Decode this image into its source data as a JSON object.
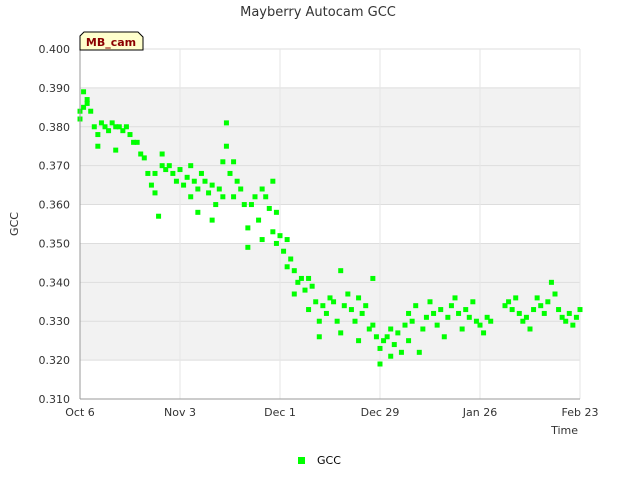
{
  "chart_data": {
    "type": "scatter",
    "title": "Mayberry Autocam GCC",
    "xlabel": "Time",
    "ylabel": "GCC",
    "badge": "MB_cam",
    "x_type": "date",
    "x_range": [
      "2014-10-06",
      "2015-02-23"
    ],
    "ylim": [
      0.31,
      0.4
    ],
    "yticks": [
      "0.310",
      "0.320",
      "0.330",
      "0.340",
      "0.350",
      "0.360",
      "0.370",
      "0.380",
      "0.390",
      "0.400"
    ],
    "xticks": [
      {
        "date": "2014-10-06",
        "label": "Oct 6"
      },
      {
        "date": "2014-11-03",
        "label": "Nov 3"
      },
      {
        "date": "2014-12-01",
        "label": "Dec 1"
      },
      {
        "date": "2014-12-29",
        "label": "Dec 29"
      },
      {
        "date": "2015-01-26",
        "label": "Jan 26"
      },
      {
        "date": "2015-02-23",
        "label": "Feb 23"
      }
    ],
    "grid": true,
    "legend_position": "bottom-center",
    "series": [
      {
        "name": "GCC",
        "color": "#00ff00",
        "points": [
          [
            "2014-10-06",
            0.382
          ],
          [
            "2014-10-06",
            0.384
          ],
          [
            "2014-10-07",
            0.385
          ],
          [
            "2014-10-07",
            0.389
          ],
          [
            "2014-10-08",
            0.387
          ],
          [
            "2014-10-08",
            0.386
          ],
          [
            "2014-10-09",
            0.384
          ],
          [
            "2014-10-10",
            0.38
          ],
          [
            "2014-10-11",
            0.378
          ],
          [
            "2014-10-11",
            0.375
          ],
          [
            "2014-10-12",
            0.381
          ],
          [
            "2014-10-13",
            0.38
          ],
          [
            "2014-10-14",
            0.379
          ],
          [
            "2014-10-15",
            0.381
          ],
          [
            "2014-10-16",
            0.38
          ],
          [
            "2014-10-16",
            0.374
          ],
          [
            "2014-10-17",
            0.38
          ],
          [
            "2014-10-18",
            0.379
          ],
          [
            "2014-10-19",
            0.38
          ],
          [
            "2014-10-20",
            0.378
          ],
          [
            "2014-10-21",
            0.376
          ],
          [
            "2014-10-22",
            0.376
          ],
          [
            "2014-10-23",
            0.373
          ],
          [
            "2014-10-24",
            0.372
          ],
          [
            "2014-10-25",
            0.368
          ],
          [
            "2014-10-26",
            0.365
          ],
          [
            "2014-10-27",
            0.363
          ],
          [
            "2014-10-27",
            0.368
          ],
          [
            "2014-10-28",
            0.357
          ],
          [
            "2014-10-29",
            0.37
          ],
          [
            "2014-10-29",
            0.373
          ],
          [
            "2014-10-30",
            0.369
          ],
          [
            "2014-10-31",
            0.37
          ],
          [
            "2014-11-01",
            0.368
          ],
          [
            "2014-11-02",
            0.366
          ],
          [
            "2014-11-03",
            0.369
          ],
          [
            "2014-11-04",
            0.365
          ],
          [
            "2014-11-05",
            0.367
          ],
          [
            "2014-11-06",
            0.37
          ],
          [
            "2014-11-06",
            0.362
          ],
          [
            "2014-11-07",
            0.366
          ],
          [
            "2014-11-08",
            0.358
          ],
          [
            "2014-11-08",
            0.364
          ],
          [
            "2014-11-09",
            0.368
          ],
          [
            "2014-11-10",
            0.366
          ],
          [
            "2014-11-11",
            0.363
          ],
          [
            "2014-11-12",
            0.365
          ],
          [
            "2014-11-12",
            0.356
          ],
          [
            "2014-11-13",
            0.36
          ],
          [
            "2014-11-14",
            0.364
          ],
          [
            "2014-11-15",
            0.362
          ],
          [
            "2014-11-15",
            0.371
          ],
          [
            "2014-11-16",
            0.375
          ],
          [
            "2014-11-16",
            0.381
          ],
          [
            "2014-11-17",
            0.368
          ],
          [
            "2014-11-18",
            0.371
          ],
          [
            "2014-11-18",
            0.362
          ],
          [
            "2014-11-19",
            0.366
          ],
          [
            "2014-11-20",
            0.364
          ],
          [
            "2014-11-21",
            0.36
          ],
          [
            "2014-11-22",
            0.354
          ],
          [
            "2014-11-22",
            0.349
          ],
          [
            "2014-11-23",
            0.36
          ],
          [
            "2014-11-24",
            0.362
          ],
          [
            "2014-11-25",
            0.356
          ],
          [
            "2014-11-26",
            0.364
          ],
          [
            "2014-11-26",
            0.351
          ],
          [
            "2014-11-27",
            0.362
          ],
          [
            "2014-11-28",
            0.359
          ],
          [
            "2014-11-29",
            0.366
          ],
          [
            "2014-11-29",
            0.353
          ],
          [
            "2014-11-30",
            0.358
          ],
          [
            "2014-11-30",
            0.35
          ],
          [
            "2014-12-01",
            0.352
          ],
          [
            "2014-12-02",
            0.348
          ],
          [
            "2014-12-03",
            0.344
          ],
          [
            "2014-12-03",
            0.351
          ],
          [
            "2014-12-04",
            0.346
          ],
          [
            "2014-12-05",
            0.343
          ],
          [
            "2014-12-05",
            0.337
          ],
          [
            "2014-12-06",
            0.34
          ],
          [
            "2014-12-07",
            0.341
          ],
          [
            "2014-12-08",
            0.338
          ],
          [
            "2014-12-09",
            0.341
          ],
          [
            "2014-12-09",
            0.333
          ],
          [
            "2014-12-10",
            0.339
          ],
          [
            "2014-12-11",
            0.335
          ],
          [
            "2014-12-12",
            0.33
          ],
          [
            "2014-12-12",
            0.326
          ],
          [
            "2014-12-13",
            0.334
          ],
          [
            "2014-12-14",
            0.332
          ],
          [
            "2014-12-15",
            0.336
          ],
          [
            "2014-12-16",
            0.335
          ],
          [
            "2014-12-17",
            0.33
          ],
          [
            "2014-12-18",
            0.343
          ],
          [
            "2014-12-18",
            0.327
          ],
          [
            "2014-12-19",
            0.334
          ],
          [
            "2014-12-20",
            0.337
          ],
          [
            "2014-12-21",
            0.333
          ],
          [
            "2014-12-22",
            0.33
          ],
          [
            "2014-12-23",
            0.336
          ],
          [
            "2014-12-23",
            0.325
          ],
          [
            "2014-12-24",
            0.332
          ],
          [
            "2014-12-25",
            0.334
          ],
          [
            "2014-12-26",
            0.328
          ],
          [
            "2014-12-27",
            0.329
          ],
          [
            "2014-12-27",
            0.341
          ],
          [
            "2014-12-28",
            0.326
          ],
          [
            "2014-12-29",
            0.323
          ],
          [
            "2014-12-29",
            0.319
          ],
          [
            "2014-12-30",
            0.325
          ],
          [
            "2014-12-31",
            0.326
          ],
          [
            "2015-01-01",
            0.328
          ],
          [
            "2015-01-01",
            0.321
          ],
          [
            "2015-01-02",
            0.324
          ],
          [
            "2015-01-03",
            0.327
          ],
          [
            "2015-01-04",
            0.322
          ],
          [
            "2015-01-05",
            0.329
          ],
          [
            "2015-01-06",
            0.332
          ],
          [
            "2015-01-06",
            0.325
          ],
          [
            "2015-01-07",
            0.33
          ],
          [
            "2015-01-08",
            0.334
          ],
          [
            "2015-01-09",
            0.322
          ],
          [
            "2015-01-10",
            0.328
          ],
          [
            "2015-01-11",
            0.331
          ],
          [
            "2015-01-12",
            0.335
          ],
          [
            "2015-01-13",
            0.332
          ],
          [
            "2015-01-14",
            0.329
          ],
          [
            "2015-01-15",
            0.333
          ],
          [
            "2015-01-16",
            0.326
          ],
          [
            "2015-01-17",
            0.331
          ],
          [
            "2015-01-18",
            0.334
          ],
          [
            "2015-01-19",
            0.336
          ],
          [
            "2015-01-20",
            0.332
          ],
          [
            "2015-01-21",
            0.328
          ],
          [
            "2015-01-22",
            0.333
          ],
          [
            "2015-01-23",
            0.331
          ],
          [
            "2015-01-24",
            0.335
          ],
          [
            "2015-01-25",
            0.33
          ],
          [
            "2015-01-26",
            0.329
          ],
          [
            "2015-01-27",
            0.327
          ],
          [
            "2015-01-28",
            0.331
          ],
          [
            "2015-01-29",
            0.33
          ],
          [
            "2015-02-02",
            0.334
          ],
          [
            "2015-02-03",
            0.335
          ],
          [
            "2015-02-04",
            0.333
          ],
          [
            "2015-02-05",
            0.336
          ],
          [
            "2015-02-06",
            0.332
          ],
          [
            "2015-02-07",
            0.33
          ],
          [
            "2015-02-08",
            0.331
          ],
          [
            "2015-02-09",
            0.328
          ],
          [
            "2015-02-10",
            0.333
          ],
          [
            "2015-02-11",
            0.336
          ],
          [
            "2015-02-12",
            0.334
          ],
          [
            "2015-02-13",
            0.332
          ],
          [
            "2015-02-14",
            0.335
          ],
          [
            "2015-02-15",
            0.34
          ],
          [
            "2015-02-16",
            0.337
          ],
          [
            "2015-02-17",
            0.333
          ],
          [
            "2015-02-18",
            0.331
          ],
          [
            "2015-02-19",
            0.33
          ],
          [
            "2015-02-20",
            0.332
          ],
          [
            "2015-02-21",
            0.329
          ],
          [
            "2015-02-22",
            0.331
          ],
          [
            "2015-02-23",
            0.333
          ]
        ]
      }
    ]
  }
}
